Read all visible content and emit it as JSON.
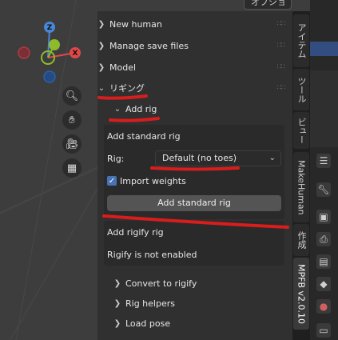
{
  "top_menu": {
    "options_label": "オプション"
  },
  "gizmo": {
    "z": "Z",
    "x": "X"
  },
  "nav_icons": [
    "zoom-icon",
    "hand-icon",
    "camera-icon",
    "grid-icon"
  ],
  "panels": [
    {
      "label": "New human",
      "collapsed": true
    },
    {
      "label": "Manage save files",
      "collapsed": true
    },
    {
      "label": "Model",
      "collapsed": true
    },
    {
      "label": "リギング",
      "collapsed": false
    }
  ],
  "add_rig": {
    "label": "Add rig",
    "standard": {
      "title": "Add standard rig",
      "rig_label": "Rig:",
      "rig_value": "Default (no toes)",
      "import_weights_label": "Import weights",
      "import_weights_checked": true,
      "button_label": "Add standard rig"
    },
    "rigify": {
      "title": "Add rigify rig",
      "status": "Rigify is not enabled"
    }
  },
  "subpanels": [
    {
      "label": "Convert to rigify"
    },
    {
      "label": "Rig helpers"
    },
    {
      "label": "Load pose"
    }
  ],
  "tabs": [
    {
      "label": "アイテム"
    },
    {
      "label": "ツール"
    },
    {
      "label": "ビュー"
    },
    {
      "label": "MakeHuman"
    },
    {
      "label": "作成"
    },
    {
      "label": "MPFB v2.0.10"
    }
  ],
  "colors": {
    "accent_blue": "#4772b3",
    "annotation_red": "#d81d1d",
    "axis_x": "#e04848",
    "axis_y": "#8dbb2b",
    "axis_z": "#4a86d6"
  }
}
